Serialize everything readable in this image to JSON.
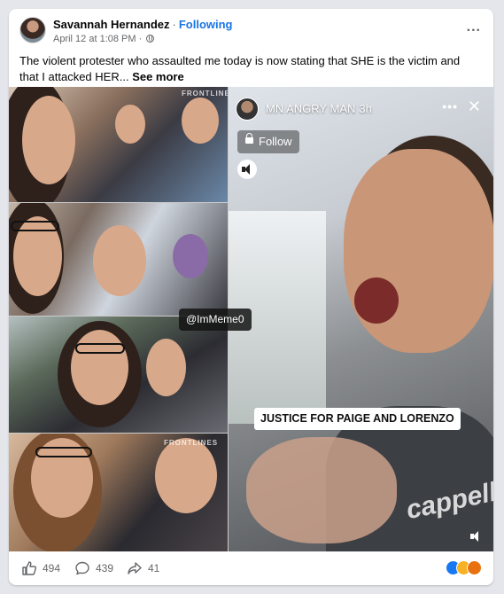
{
  "post": {
    "author": "Savannah Hernandez",
    "separator": "·",
    "follow_label": "Following",
    "timestamp": "April 12 at 1:08 PM",
    "audience_separator": "·",
    "text": "The violent protester who assaulted me today is now stating that SHE is the victim and that I attacked HER...",
    "see_more": "See more",
    "more_icon": "..."
  },
  "media": {
    "watermark_top": "FRONTLINES",
    "watermark_bottom": "FRONTLINES",
    "handle_tag": "@ImMeme0",
    "reel": {
      "account_name": "MN ANGRY MAN",
      "time": "3h",
      "follow_label": "Follow",
      "more_icon": "•••",
      "close_icon": "✕",
      "caption": "JUSTICE FOR PAIGE AND LORENZO",
      "brand_text": "cappelli"
    }
  },
  "footer": {
    "likes": "494",
    "comments": "439",
    "shares": "41"
  },
  "colors": {
    "accent": "#1b74e4",
    "secondary_text": "#65676b",
    "like_blue": "#1877f2",
    "haha_yellow": "#f7b125",
    "angry_orange": "#e9710f"
  }
}
